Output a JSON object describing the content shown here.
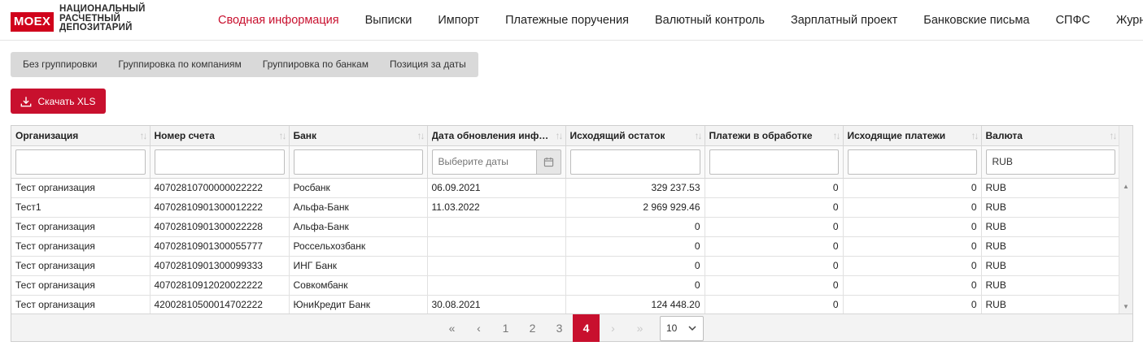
{
  "header": {
    "logo_badge": "MOEX",
    "logo_lines": [
      "НАЦИОНАЛЬНЫЙ",
      "РАСЧЕТНЫЙ",
      "ДЕПОЗИТАРИЙ"
    ],
    "nav": [
      {
        "label": "Сводная информация",
        "active": true
      },
      {
        "label": "Выписки"
      },
      {
        "label": "Импорт"
      },
      {
        "label": "Платежные поручения"
      },
      {
        "label": "Валютный контроль"
      },
      {
        "label": "Зарплатный проект"
      },
      {
        "label": "Банковские письма"
      },
      {
        "label": "СПФС"
      },
      {
        "label": "Журнал"
      }
    ]
  },
  "group_tabs": [
    "Без группировки",
    "Группировка по компаниям",
    "Группировка по банкам",
    "Позиция за даты"
  ],
  "download_label": "Скачать XLS",
  "grid": {
    "columns": [
      {
        "label": "Организация"
      },
      {
        "label": "Номер счета"
      },
      {
        "label": "Банк"
      },
      {
        "label": "Дата обновления инфор..."
      },
      {
        "label": "Исходящий остаток"
      },
      {
        "label": "Платежи в обработке"
      },
      {
        "label": "Исходящие платежи"
      },
      {
        "label": "Валюта"
      }
    ],
    "filters": {
      "org": "",
      "account": "",
      "bank": "",
      "date_placeholder": "Выберите даты",
      "balance": "",
      "processing": "",
      "outgoing": "",
      "currency": "RUB"
    },
    "rows": [
      [
        "Тест организация",
        "40702810700000022222",
        "Росбанк",
        "06.09.2021",
        "329 237.53",
        "0",
        "0",
        "RUB"
      ],
      [
        "Тест1",
        "40702810901300012222",
        "Альфа-Банк",
        "11.03.2022",
        "2 969 929.46",
        "0",
        "0",
        "RUB"
      ],
      [
        "Тест организация",
        "40702810901300022228",
        "Альфа-Банк",
        "",
        "0",
        "0",
        "0",
        "RUB"
      ],
      [
        "Тест организация",
        "40702810901300055777",
        "Россельхозбанк",
        "",
        "0",
        "0",
        "0",
        "RUB"
      ],
      [
        "Тест организация",
        "40702810901300099333",
        "ИНГ Банк",
        "",
        "0",
        "0",
        "0",
        "RUB"
      ],
      [
        "Тест организация",
        "40702810912020022222",
        "Совкомбанк",
        "",
        "0",
        "0",
        "0",
        "RUB"
      ],
      [
        "Тест организация",
        "42002810500014702222",
        "ЮниКредит Банк",
        "30.08.2021",
        "124 448.20",
        "0",
        "0",
        "RUB"
      ]
    ]
  },
  "pager": {
    "first": "«",
    "prev": "‹",
    "pages": [
      "1",
      "2",
      "3",
      "4"
    ],
    "current": "4",
    "next": "›",
    "last": "»",
    "page_size": "10"
  },
  "colors": {
    "brand": "#c8102e",
    "logo": "#d0021b"
  },
  "icons": {
    "download": "download-icon",
    "calendar": "calendar-icon",
    "sort": "sort-icon",
    "dropdown": "chevron-down-icon"
  }
}
